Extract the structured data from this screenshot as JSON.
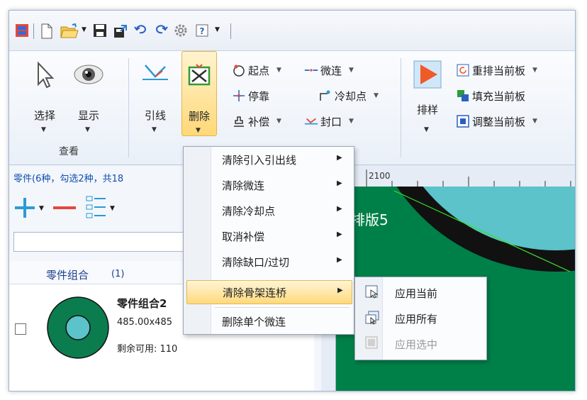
{
  "ribbon": {
    "view_group": {
      "label": "查看",
      "select": "选择",
      "show": "显示"
    },
    "lead_group": {
      "lead_line": "引线",
      "delete": "删除",
      "start_point": "起点",
      "micro_joint": "微连",
      "dock": "停靠",
      "cooling_point": "冷却点",
      "compensate": "补偿",
      "seal": "封口"
    },
    "nest_group": {
      "nest": "排样",
      "re_nest": "重排当前板",
      "fill": "填充当前板",
      "adjust": "调整当前板"
    }
  },
  "delete_menu": {
    "items": [
      {
        "label": "清除引入引出线",
        "has_submenu": true
      },
      {
        "label": "清除微连",
        "has_submenu": true
      },
      {
        "label": "清除冷却点",
        "has_submenu": true
      },
      {
        "label": "取消补偿",
        "has_submenu": true
      },
      {
        "label": "清除缺口/过切",
        "has_submenu": true
      },
      {
        "label": "清除骨架连桥",
        "has_submenu": true,
        "highlighted": true
      },
      {
        "label": "删除单个微连",
        "has_submenu": false
      }
    ]
  },
  "submenu": {
    "items": [
      {
        "label": "应用当前",
        "enabled": true
      },
      {
        "label": "应用所有",
        "enabled": true
      },
      {
        "label": "应用选中",
        "enabled": false
      }
    ]
  },
  "parts_panel": {
    "header": "零件(6种，勾选2种，共18",
    "group_name": "零件组合",
    "group_count": "(1)",
    "item": {
      "title": "零件组合2",
      "size": "485.00x485",
      "remaining": "剩余可用: 110"
    }
  },
  "canvas": {
    "ruler_label": "2100",
    "sheet_label": "排版5"
  },
  "colors": {
    "canvas_bg": "#008049",
    "part_fill": "#5bc3c9",
    "highlight": "#ffd97c",
    "accent_blue": "#1e88e5"
  }
}
